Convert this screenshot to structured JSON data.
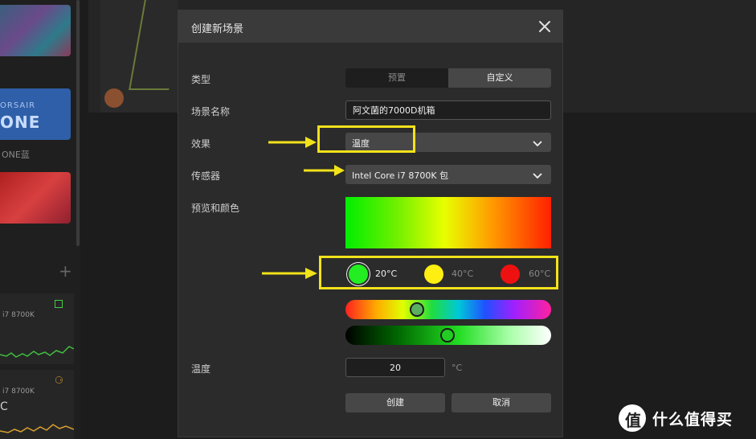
{
  "background": {
    "tile_brand": "ORSAIR",
    "tile_logo": "ONE",
    "tile_label": "ONE蓝",
    "card1_cpu": "i7 8700K",
    "card2_cpu": "i7 8700K",
    "card2_big": "C"
  },
  "dialog": {
    "title": "创建新场景",
    "type_label": "类型",
    "type_options": [
      "预置",
      "自定义"
    ],
    "type_selected": "自定义",
    "name_label": "场景名称",
    "name_value": "阿文菌的7000D机箱",
    "effect_label": "效果",
    "effect_value": "温度",
    "sensor_label": "传感器",
    "sensor_value": "Intel Core i7 8700K 包",
    "preview_label": "预览和颜色",
    "swatches": [
      {
        "label": "20°C",
        "color": "#22ee22",
        "selected": true
      },
      {
        "label": "40°C",
        "color": "#ffee11",
        "selected": false
      },
      {
        "label": "60°C",
        "color": "#ee1111",
        "selected": false
      }
    ],
    "temp_label": "温度",
    "temp_value": "20",
    "temp_unit": "°C",
    "create_label": "创建",
    "cancel_label": "取消"
  },
  "colors": {
    "highlight": "#f2e21a",
    "dialog_bg": "#2b2b2b",
    "header_bg": "#3a3a3a"
  },
  "watermark": {
    "logo_char": "值",
    "text": "什么值得买"
  }
}
